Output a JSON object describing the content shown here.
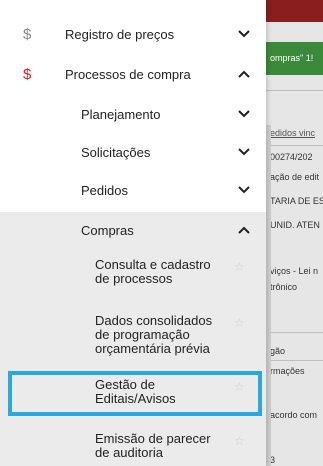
{
  "background": {
    "green_banner": "ompras\" 1!",
    "col_header": "edidos vinc",
    "rows": [
      "00274/202",
      "ação de edit",
      "TARIA DE ES",
      "UNID. ATEN",
      "viços - Lei n",
      "trônico",
      "gão",
      "rmações",
      "acordo com",
      "3"
    ]
  },
  "menu": {
    "registro": {
      "icon": "$",
      "label": "Registro de preços"
    },
    "processos": {
      "icon": "$",
      "label": "Processos de compra"
    },
    "planejamento": {
      "label": "Planejamento"
    },
    "solicitacoes": {
      "label": "Solicitações"
    },
    "pedidos": {
      "label": "Pedidos"
    },
    "compras": {
      "label": "Compras"
    },
    "sub": [
      {
        "label": "Consulta e cadastro de processos",
        "star": "☆"
      },
      {
        "label": "Dados consolidados de programação orçamentária prévia",
        "star": "☆"
      },
      {
        "label": "Gestão de Editais/Avisos",
        "star": "☆"
      },
      {
        "label": "Emissão de parecer de auditoria",
        "star": "☆"
      }
    ]
  },
  "colors": {
    "accent_red": "#e02020",
    "selection": "#2aa9e0",
    "grey_icon": "#8a8a8a"
  }
}
